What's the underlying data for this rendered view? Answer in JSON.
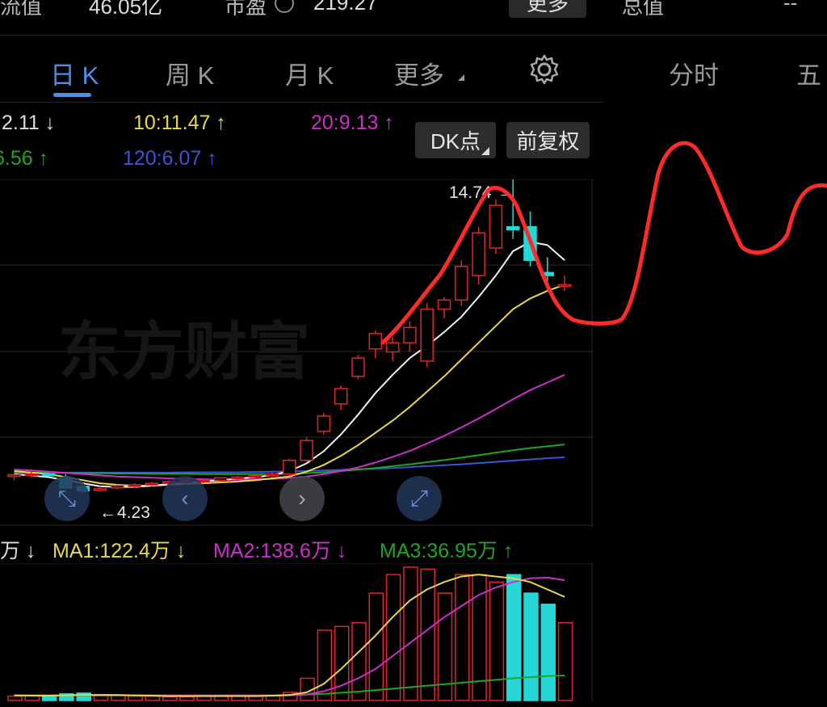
{
  "header": {
    "float_value_label": "流值",
    "float_value": "46.05亿",
    "pe_label": "市盈",
    "pe_value": "219.27",
    "more_button": "更多",
    "total_label": "总值",
    "total_value": "--"
  },
  "tabs": [
    {
      "label": "日 K",
      "active": true
    },
    {
      "label": "周 K",
      "active": false
    },
    {
      "label": "月 K",
      "active": false
    },
    {
      "label": "更多",
      "active": false
    }
  ],
  "right_tabs": {
    "intraday": "分时",
    "five_day": "五"
  },
  "ma_lines": {
    "ma5": "2.11",
    "ma10": "10:11.47",
    "ma20": "20:9.13",
    "ma60": "6.56",
    "ma120": "120:6.07"
  },
  "buttons": {
    "dk": "DK点",
    "adjust": "前复权"
  },
  "chart_labels": {
    "high": "14.74",
    "low": "4.23",
    "watermark": "东方财富"
  },
  "volume_ma": {
    "vol": "万",
    "ma1": "MA1:122.4万",
    "ma2": "MA2:138.6万",
    "ma3": "MA3:36.95万"
  },
  "colors": {
    "up": "#e0242b",
    "down": "#27d7d7",
    "accent": "#4a8fe8",
    "ma10": "#e8d84a",
    "ma20": "#cc2fcc",
    "ma60": "#1fa61f",
    "ma120": "#3b54d6"
  },
  "chart_data": {
    "type": "candlestick",
    "high_label": 14.74,
    "low_label": 4.23,
    "candles": [
      {
        "o": 4.75,
        "h": 4.85,
        "l": 4.6,
        "c": 4.78
      },
      {
        "o": 4.78,
        "h": 4.9,
        "l": 4.7,
        "c": 4.8
      },
      {
        "o": 4.8,
        "h": 4.85,
        "l": 4.72,
        "c": 4.76
      },
      {
        "o": 4.65,
        "h": 4.8,
        "l": 4.3,
        "c": 4.35
      },
      {
        "o": 4.4,
        "h": 4.45,
        "l": 4.2,
        "c": 4.25
      },
      {
        "o": 4.3,
        "h": 4.4,
        "l": 4.23,
        "c": 4.32
      },
      {
        "o": 4.35,
        "h": 4.45,
        "l": 4.3,
        "c": 4.42
      },
      {
        "o": 4.42,
        "h": 4.5,
        "l": 4.35,
        "c": 4.45
      },
      {
        "o": 4.45,
        "h": 4.55,
        "l": 4.4,
        "c": 4.5
      },
      {
        "o": 4.5,
        "h": 4.58,
        "l": 4.42,
        "c": 4.55
      },
      {
        "o": 4.55,
        "h": 4.62,
        "l": 4.45,
        "c": 4.58
      },
      {
        "o": 4.58,
        "h": 4.65,
        "l": 4.5,
        "c": 4.6
      },
      {
        "o": 4.6,
        "h": 4.7,
        "l": 4.55,
        "c": 4.68
      },
      {
        "o": 4.68,
        "h": 4.75,
        "l": 4.6,
        "c": 4.7
      },
      {
        "o": 4.7,
        "h": 4.8,
        "l": 4.65,
        "c": 4.75
      },
      {
        "o": 4.75,
        "h": 4.85,
        "l": 4.7,
        "c": 4.8
      },
      {
        "o": 4.8,
        "h": 5.3,
        "l": 4.75,
        "c": 5.25
      },
      {
        "o": 5.25,
        "h": 6.0,
        "l": 5.2,
        "c": 5.9
      },
      {
        "o": 6.2,
        "h": 6.8,
        "l": 6.1,
        "c": 6.7
      },
      {
        "o": 7.1,
        "h": 7.7,
        "l": 6.9,
        "c": 7.6
      },
      {
        "o": 8.0,
        "h": 8.7,
        "l": 7.9,
        "c": 8.6
      },
      {
        "o": 8.9,
        "h": 9.5,
        "l": 8.6,
        "c": 9.4
      },
      {
        "o": 8.8,
        "h": 9.3,
        "l": 8.5,
        "c": 9.1
      },
      {
        "o": 9.1,
        "h": 9.8,
        "l": 8.8,
        "c": 9.6
      },
      {
        "o": 8.5,
        "h": 10.4,
        "l": 8.3,
        "c": 10.2
      },
      {
        "o": 10.2,
        "h": 10.6,
        "l": 9.9,
        "c": 10.5
      },
      {
        "o": 10.5,
        "h": 11.8,
        "l": 10.3,
        "c": 11.6
      },
      {
        "o": 11.3,
        "h": 12.9,
        "l": 11.0,
        "c": 12.7
      },
      {
        "o": 12.2,
        "h": 13.8,
        "l": 12.0,
        "c": 13.6
      },
      {
        "o": 12.9,
        "h": 14.74,
        "l": 12.5,
        "c": 12.8
      },
      {
        "o": 12.9,
        "h": 13.4,
        "l": 11.6,
        "c": 11.8
      },
      {
        "o": 11.4,
        "h": 11.9,
        "l": 11.0,
        "c": 11.3
      },
      {
        "o": 11.0,
        "h": 11.3,
        "l": 10.8,
        "c": 11.0
      }
    ],
    "ma10": [
      4.9,
      4.85,
      4.8,
      4.7,
      4.6,
      4.5,
      4.45,
      4.42,
      4.42,
      4.45,
      4.48,
      4.5,
      4.53,
      4.56,
      4.6,
      4.66,
      4.72,
      4.88,
      5.1,
      5.4,
      5.75,
      6.15,
      6.55,
      7.0,
      7.5,
      8.0,
      8.55,
      9.1,
      9.65,
      10.2,
      10.55,
      10.8,
      11.0
    ],
    "ma5": [
      4.8,
      4.75,
      4.7,
      4.6,
      4.5,
      4.4,
      4.38,
      4.38,
      4.42,
      4.47,
      4.52,
      4.56,
      4.6,
      4.65,
      4.7,
      4.76,
      4.9,
      5.15,
      5.55,
      6.1,
      6.75,
      7.45,
      8.05,
      8.6,
      9.0,
      9.45,
      9.95,
      10.6,
      11.3,
      12.1,
      12.4,
      12.3,
      11.8
    ],
    "ma20": [
      4.95,
      4.92,
      4.88,
      4.84,
      4.8,
      4.76,
      4.72,
      4.7,
      4.68,
      4.66,
      4.64,
      4.63,
      4.62,
      4.62,
      4.63,
      4.64,
      4.67,
      4.72,
      4.8,
      4.9,
      5.02,
      5.18,
      5.36,
      5.56,
      5.8,
      6.05,
      6.33,
      6.62,
      6.93,
      7.25,
      7.55,
      7.8,
      8.05
    ],
    "ma60": [
      4.85,
      4.85,
      4.84,
      4.84,
      4.83,
      4.83,
      4.82,
      4.82,
      4.81,
      4.81,
      4.81,
      4.8,
      4.8,
      4.8,
      4.8,
      4.8,
      4.81,
      4.83,
      4.86,
      4.9,
      4.95,
      5.0,
      5.06,
      5.12,
      5.19,
      5.26,
      5.34,
      5.42,
      5.5,
      5.58,
      5.65,
      5.71,
      5.77
    ],
    "ma120": [
      4.85,
      4.85,
      4.85,
      4.85,
      4.85,
      4.85,
      4.85,
      4.85,
      4.85,
      4.85,
      4.86,
      4.86,
      4.86,
      4.86,
      4.87,
      4.88,
      4.89,
      4.9,
      4.92,
      4.94,
      4.96,
      4.98,
      5.0,
      5.03,
      5.06,
      5.09,
      5.12,
      5.16,
      5.2,
      5.24,
      5.28,
      5.32,
      5.35
    ],
    "volume": [
      12,
      14,
      10,
      18,
      20,
      16,
      14,
      12,
      12,
      10,
      10,
      12,
      12,
      14,
      12,
      14,
      22,
      60,
      190,
      200,
      210,
      290,
      340,
      360,
      355,
      290,
      340,
      340,
      320,
      340,
      290,
      260,
      210
    ],
    "volume_ma1": [
      14,
      13,
      13,
      14,
      15,
      15,
      15,
      14,
      13,
      12,
      12,
      12,
      12,
      12,
      12,
      13,
      15,
      22,
      45,
      85,
      130,
      175,
      225,
      270,
      300,
      320,
      335,
      340,
      335,
      330,
      320,
      300,
      280
    ],
    "volume_ma2": [
      14,
      14,
      14,
      14,
      14,
      14,
      14,
      14,
      14,
      13,
      13,
      13,
      13,
      13,
      13,
      13,
      14,
      16,
      25,
      40,
      60,
      85,
      120,
      155,
      190,
      225,
      255,
      285,
      305,
      320,
      330,
      332,
      325
    ],
    "volume_ma3": [
      14,
      14,
      14,
      14,
      14,
      14,
      14,
      14,
      14,
      14,
      14,
      14,
      14,
      14,
      14,
      14,
      15,
      16,
      18,
      21,
      24,
      28,
      32,
      36,
      40,
      44,
      48,
      52,
      56,
      60,
      63,
      66,
      68
    ]
  }
}
